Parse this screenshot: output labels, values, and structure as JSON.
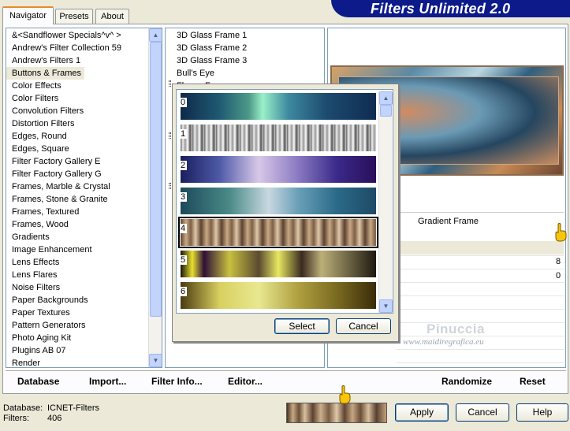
{
  "header": {
    "title": "Filters Unlimited 2.0"
  },
  "tabs": [
    {
      "label": "Navigator",
      "active": true
    },
    {
      "label": "Presets",
      "active": false
    },
    {
      "label": "About",
      "active": false
    }
  ],
  "categories": [
    "&<Sandflower Specials^v^ >",
    "Andrew's Filter Collection 59",
    "Andrew's Filters 1",
    "Buttons & Frames",
    "Color Effects",
    "Color Filters",
    "Convolution Filters",
    "Distortion Filters",
    "Edges, Round",
    "Edges, Square",
    "Filter Factory Gallery E",
    "Filter Factory Gallery G",
    "Frames, Marble & Crystal",
    "Frames, Stone & Granite",
    "Frames, Textured",
    "Frames, Wood",
    "Gradients",
    "Image Enhancement",
    "Lens Effects",
    "Lens Flares",
    "Noise Filters",
    "Paper Backgrounds",
    "Paper Textures",
    "Pattern Generators",
    "Photo Aging Kit",
    "Plugins AB 07",
    "Render"
  ],
  "selected_category": "Buttons & Frames",
  "filters": [
    "3D Glass Frame 1",
    "3D Glass Frame 2",
    "3D Glass Frame 3",
    "Bull's Eye",
    "Flower Frame"
  ],
  "gradient_picker": {
    "items": [
      "0",
      "1",
      "2",
      "3",
      "4",
      "5",
      "6"
    ],
    "selected": "4",
    "select_label": "Select",
    "cancel_label": "Cancel"
  },
  "right_panel": {
    "filter_name": "Gradient Frame",
    "params": [
      "8",
      "0"
    ]
  },
  "watermark": {
    "name": "Pinuccia",
    "url": "www.maidiregrafica.eu"
  },
  "toolbar": {
    "database": "Database",
    "import": "Import...",
    "filter_info": "Filter Info...",
    "editor": "Editor...",
    "randomize": "Randomize",
    "reset": "Reset"
  },
  "status": {
    "database_label": "Database:",
    "database_value": "ICNET-Filters",
    "filters_label": "Filters:",
    "filters_value": "406"
  },
  "buttons": {
    "apply": "Apply",
    "cancel": "Cancel",
    "help": "Help"
  },
  "colors": {
    "title_bar": "#0c1a8a",
    "accent_tab": "#e68b2c",
    "selection_border": "#000000"
  }
}
